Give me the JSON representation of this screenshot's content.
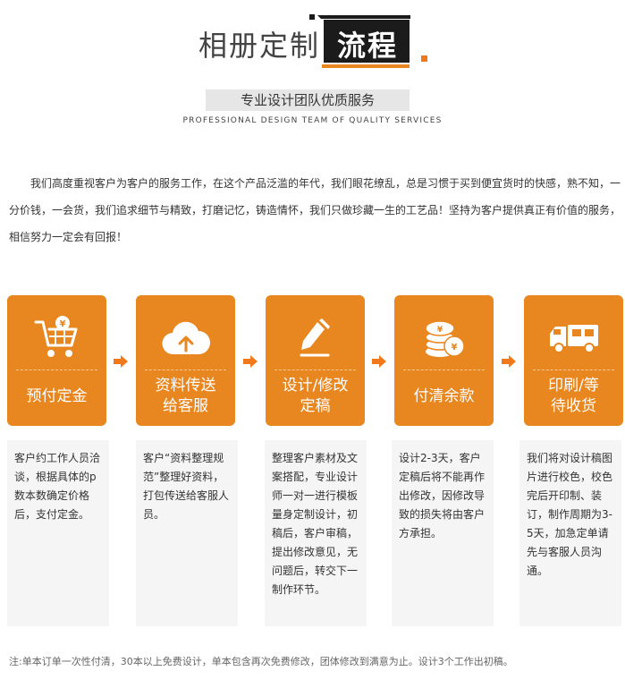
{
  "header": {
    "title_light": "相册定制",
    "title_dark": "流程",
    "subtitle": "专业设计团队优质服务",
    "subtitle_en": "PROFESSIONAL DESIGN TEAM OF QUALITY SERVICES"
  },
  "intro": "我们高度重视客户为客户的服务工作，在这个产品泛滥的年代，我们眼花缭乱，总是习惯于买到便宜货时的快感，熟不知，一分价钱，一会货，我们追求细节与精致，打磨记忆，铸造情怀，我们只做珍藏一生的工艺品！坚持为客户提供真正有价值的服务，相信努力一定会有回报！",
  "colors": {
    "accent": "#e8861f",
    "arrow": "#f07a1b",
    "desc_bg": "#f5f5f5"
  },
  "steps": [
    {
      "icon": "cart-yen-icon",
      "label": "预付定金"
    },
    {
      "icon": "cloud-upload-icon",
      "label": "资料传送\n给客服"
    },
    {
      "icon": "pen-icon",
      "label": "设计/修改\n定稿"
    },
    {
      "icon": "coins-icon",
      "label": "付清余款"
    },
    {
      "icon": "truck-icon",
      "label": "印刷/等\n待收货"
    }
  ],
  "descriptions": [
    "客户约工作人员洽谈，根据具体的p数本数确定价格后，支付定金。",
    "客户“资料整理规范”整理好资料，打包传送给客服人员。",
    "整理客户素材及文案搭配，专业设计师一对一进行模板量身定制设计，初稿后，客户审稿，提出修改意见，无问题后，转交下一制作环节。",
    "设计2-3天，客户定稿后将不能再作出修改，因修改导致的损失将由客户方承担。",
    "我们将对设计稿图片进行校色，校色完后开印制、装订，制作周期为3-5天，加急定单请先与客服人员沟通。"
  ],
  "footnote": "注:单本订单一次性付清，30本以上免费设计，单本包含再次免费修改，团体修改到满意为止。设计3个工作出初稿。"
}
